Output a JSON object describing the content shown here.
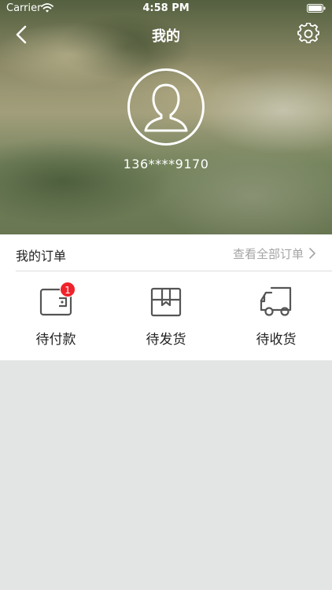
{
  "status_bar": {
    "carrier": "Carrier",
    "time": "4:58 PM"
  },
  "header": {
    "title": "我的",
    "back_icon": "chevron-left-icon",
    "settings_icon": "gear-icon"
  },
  "profile": {
    "avatar_icon": "user-avatar-icon",
    "phone": "136****9170"
  },
  "orders": {
    "title": "我的订单",
    "view_all": "查看全部订单",
    "items": [
      {
        "label": "待付款",
        "icon": "wallet-icon",
        "badge": "1"
      },
      {
        "label": "待发货",
        "icon": "package-icon"
      },
      {
        "label": "待收货",
        "icon": "truck-icon"
      }
    ]
  },
  "colors": {
    "badge": "#f0222a",
    "text_primary": "#222222",
    "text_secondary": "#a4a4a4",
    "background": "#e3e5e4"
  }
}
